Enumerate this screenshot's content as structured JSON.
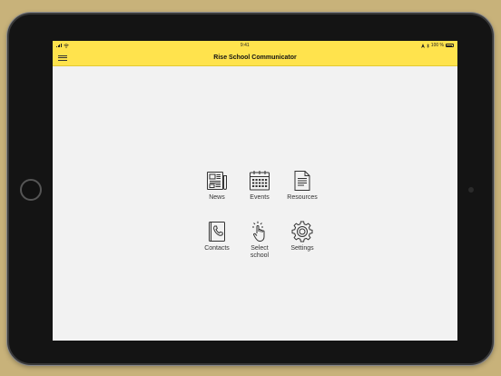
{
  "status_bar": {
    "time": "9:41",
    "battery": "100 %"
  },
  "nav": {
    "title": "Rise School Communicator"
  },
  "tiles": [
    {
      "label": "News",
      "icon": "newspaper-icon"
    },
    {
      "label": "Events",
      "icon": "calendar-icon"
    },
    {
      "label": "Resources",
      "icon": "document-icon"
    },
    {
      "label": "Contacts",
      "icon": "phone-book-icon"
    },
    {
      "label": "Select\nschool",
      "icon": "tap-hand-icon"
    },
    {
      "label": "Settings",
      "icon": "gear-icon"
    }
  ],
  "colors": {
    "header": "#ffe34d",
    "background": "#f2f2f2",
    "icon": "#333333"
  }
}
